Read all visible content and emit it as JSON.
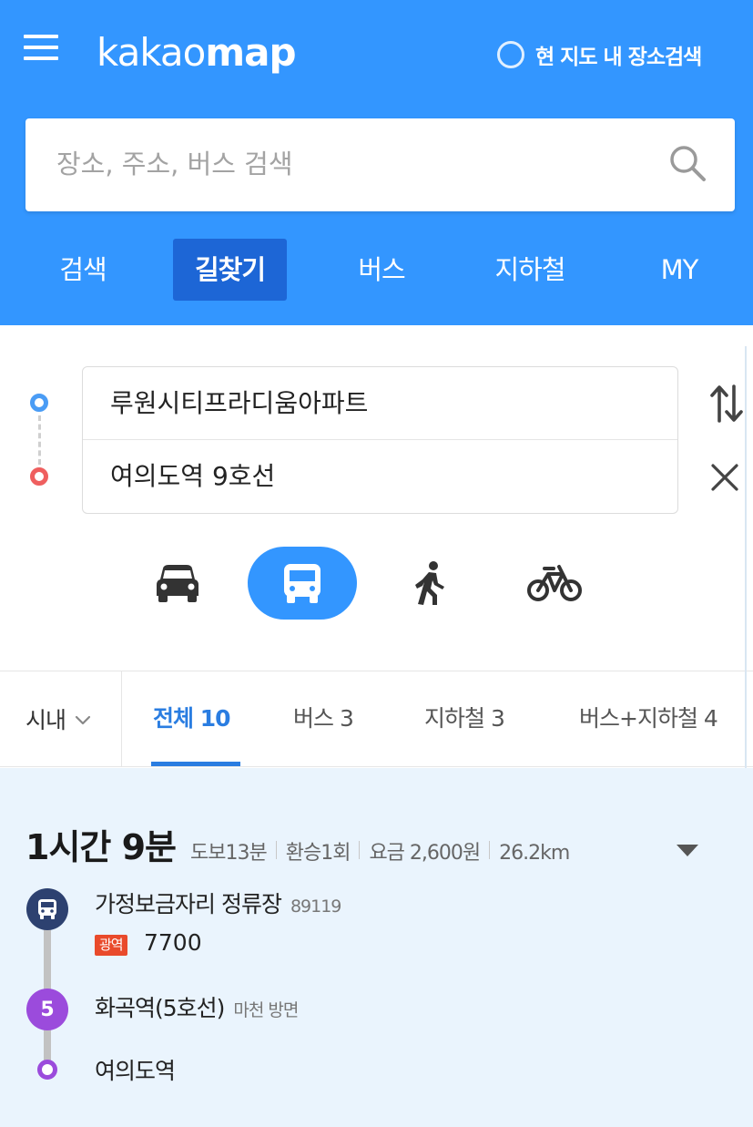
{
  "header": {
    "logo_light": "kakao",
    "logo_bold": "map",
    "map_search_toggle_label": "현 지도 내 장소검색"
  },
  "search": {
    "placeholder": "장소, 주소, 버스 검색"
  },
  "tabs": [
    {
      "label": "검색",
      "active": false
    },
    {
      "label": "길찾기",
      "active": true
    },
    {
      "label": "버스",
      "active": false
    },
    {
      "label": "지하철",
      "active": false
    },
    {
      "label": "MY",
      "active": false
    }
  ],
  "route": {
    "origin": "루원시티프라디움아파트",
    "destination": "여의도역 9호선"
  },
  "modes": [
    {
      "icon": "car-icon",
      "active": false
    },
    {
      "icon": "bus-icon",
      "active": true
    },
    {
      "icon": "walk-icon",
      "active": false
    },
    {
      "icon": "bicycle-icon",
      "active": false
    }
  ],
  "filter": {
    "region": "시내",
    "tabs": [
      {
        "label": "전체 10",
        "active": true
      },
      {
        "label": "버스 3",
        "active": false
      },
      {
        "label": "지하철 3",
        "active": false
      },
      {
        "label": "버스+지하철 4",
        "active": false
      }
    ]
  },
  "result": {
    "duration": "1시간 9분",
    "walk": "도보13분",
    "transfers": "환승1회",
    "fare": "요금 2,600원",
    "distance": "26.2km",
    "steps": [
      {
        "name": "가정보금자리 정류장",
        "sub": "89119",
        "badge": "광역",
        "bus_number": "7700"
      },
      {
        "name": "화곡역(5호선)",
        "sub": "마천 방면",
        "line": "5"
      },
      {
        "name": "여의도역"
      }
    ]
  },
  "colors": {
    "brand_blue": "#3396ff",
    "active_tab_blue": "#1d66d6",
    "accent_blue": "#2a7de1",
    "line5_purple": "#9b4bdc",
    "bus_navy": "#2d4170",
    "express_red": "#e94a2b",
    "result_bg": "#eaf4fd"
  }
}
